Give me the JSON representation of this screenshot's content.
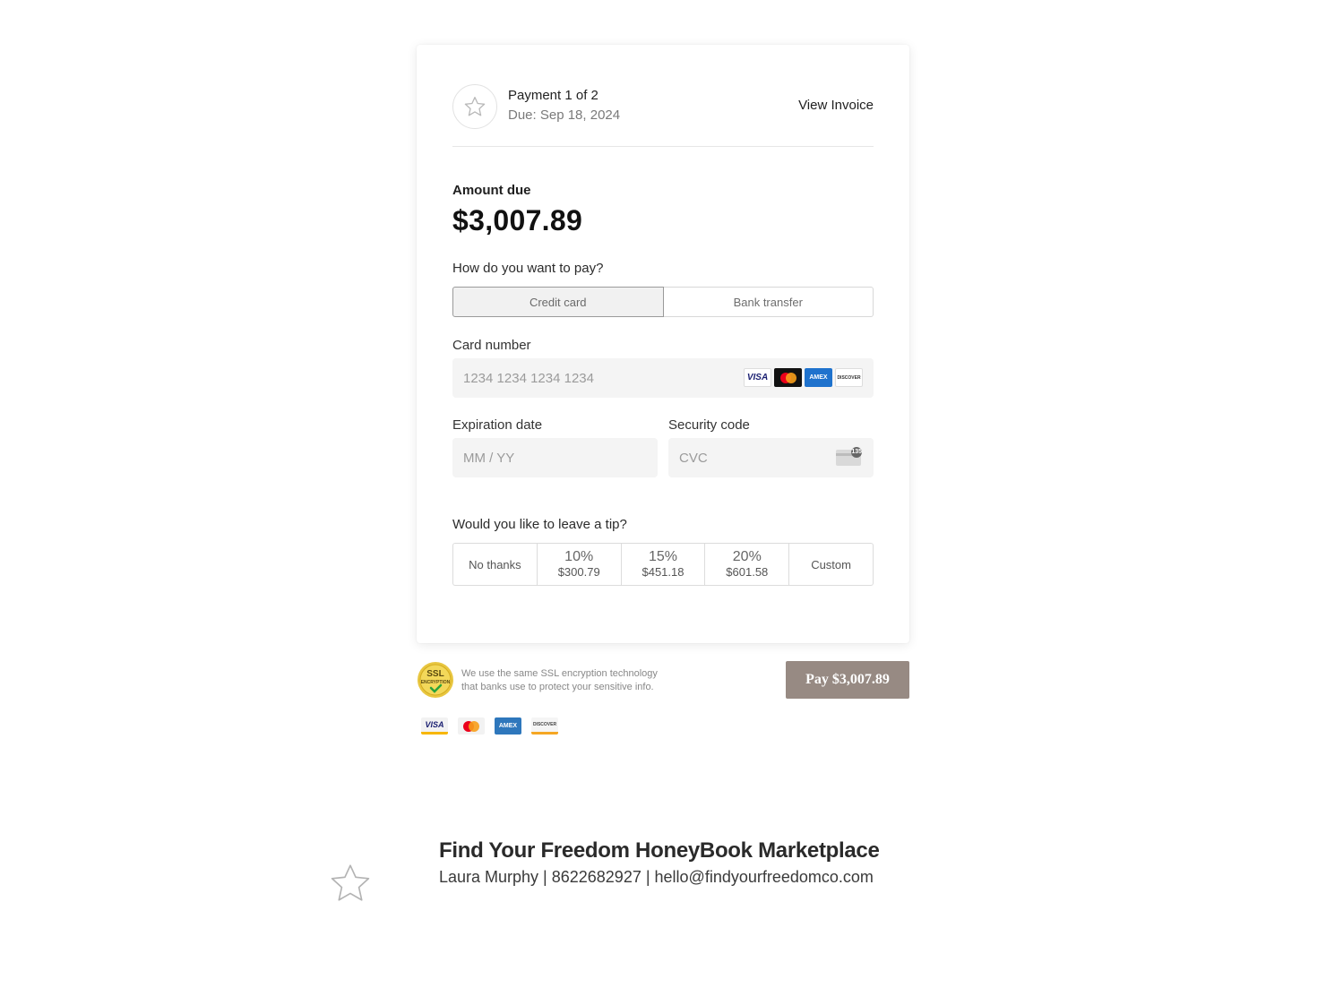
{
  "header": {
    "payment_title": "Payment 1 of 2",
    "due_date": "Due: Sep 18, 2024",
    "view_invoice": "View Invoice"
  },
  "amount": {
    "label": "Amount due",
    "value": "$3,007.89"
  },
  "payment_method": {
    "question": "How do you want to pay?",
    "options": [
      {
        "label": "Credit card",
        "selected": true
      },
      {
        "label": "Bank transfer",
        "selected": false
      }
    ]
  },
  "card_number": {
    "label": "Card number",
    "placeholder": "1234 1234 1234 1234",
    "value": "",
    "brand_logos": [
      "VISA",
      "mastercard",
      "AMEX",
      "DISCOVER"
    ]
  },
  "expiration": {
    "label": "Expiration date",
    "placeholder": "MM / YY",
    "value": ""
  },
  "security_code": {
    "label": "Security code",
    "placeholder": "CVC",
    "value": "",
    "hint_digits": "135"
  },
  "tip": {
    "question": "Would you like to leave a tip?",
    "no_thanks": "No thanks",
    "options": [
      {
        "pct": "10%",
        "amount": "$300.79"
      },
      {
        "pct": "15%",
        "amount": "$451.18"
      },
      {
        "pct": "20%",
        "amount": "$601.58"
      }
    ],
    "custom": "Custom"
  },
  "security": {
    "badge_line1": "SSL",
    "badge_line2": "ENCRYPTION",
    "text_line1": "We use the same SSL encryption technology",
    "text_line2": "that banks use to protect your sensitive info."
  },
  "pay_button": "Pay $3,007.89",
  "bottom_logos": [
    "VISA",
    "mastercard",
    "AMEX",
    "DISCOVER"
  ],
  "footer": {
    "business_name": "Find Your Freedom HoneyBook Marketplace",
    "contact": "Laura Murphy | 8622682927 | hello@findyourfreedomco.com"
  },
  "colors": {
    "pay_button_bg": "#978a83",
    "selected_method_bg": "#f1f1f1",
    "input_bg": "#f4f4f4"
  }
}
